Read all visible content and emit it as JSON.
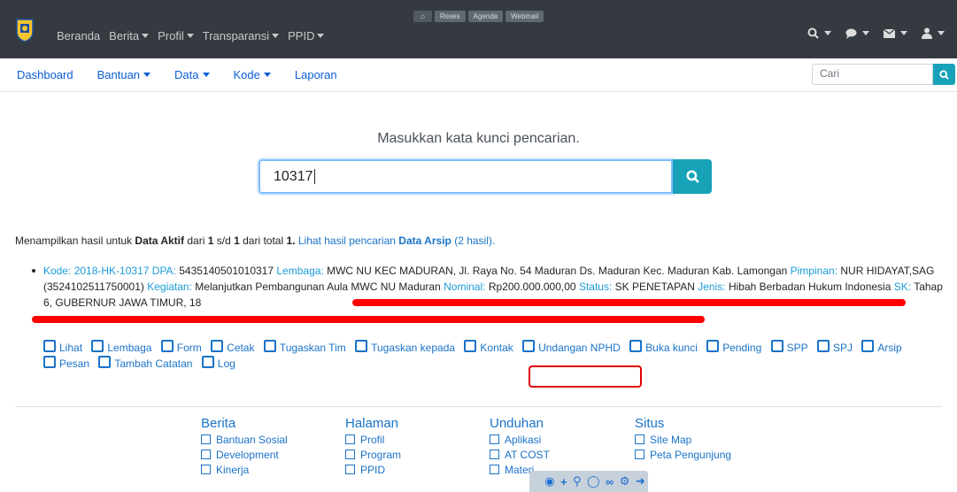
{
  "topbar": {
    "nav": [
      {
        "label": "Beranda",
        "dropdown": false
      },
      {
        "label": "Berita",
        "dropdown": true
      },
      {
        "label": "Profil",
        "dropdown": true
      },
      {
        "label": "Transparansi",
        "dropdown": true
      },
      {
        "label": "PPID",
        "dropdown": true
      }
    ],
    "quicklinks": [
      "Reses",
      "Agenda",
      "Webmail"
    ],
    "icons": [
      "home-icon",
      "search-icon",
      "chat-icon",
      "mail-icon",
      "user-icon"
    ]
  },
  "subnav": {
    "links": [
      {
        "label": "Dashboard"
      },
      {
        "label": "Bantuan"
      },
      {
        "label": "Data"
      },
      {
        "label": "Kode"
      },
      {
        "label": "Laporan"
      }
    ],
    "search_placeholder": "Cari"
  },
  "search": {
    "prompt": "Masukkan kata kunci pencarian.",
    "value": "10317"
  },
  "summary": {
    "prefix": "Menampilkan hasil untuk",
    "dataset": "Data Aktif",
    "dari": "dari",
    "from": "1",
    "sd": "s/d",
    "to": "1",
    "dari_total": "dari total",
    "total": "1.",
    "archive_link_prefix": "Lihat hasil pencarian",
    "archive_link_bold": "Data Arsip",
    "archive_link_count": "(2 hasil)."
  },
  "result": {
    "kode_label": "Kode:",
    "kode": "2018-HK-10317",
    "dpa_label": "DPA:",
    "dpa": "5435140501010317",
    "lembaga_label": "Lembaga:",
    "lembaga": "MWC NU KEC MADURAN, Jl. Raya No. 54 Maduran Ds. Maduran Kec. Maduran Kab. Lamongan",
    "pimpinan_label": "Pimpinan:",
    "pimpinan": "NUR HIDAYAT,SAG (3524102511750001)",
    "kegiatan_label": "Kegiatan:",
    "kegiatan": "Melanjutkan Pembangunan Aula MWC NU Maduran",
    "nominal_label": "Nominal:",
    "nominal": "Rp200.000.000,00",
    "status_label": "Status:",
    "status": "SK PENETAPAN",
    "jenis_label": "Jenis:",
    "jenis": "Hibah Berbadan Hukum Indonesia",
    "sk_label": "SK:",
    "sk": "Tahap 6, GUBERNUR JAWA TIMUR, 18",
    "actions": [
      "Lihat",
      "Lembaga",
      "Form",
      "Cetak",
      "Tugaskan Tim",
      "Tugaskan kepada",
      "Kontak",
      "Undangan NPHD",
      "Buka kunci",
      "Pending",
      "SPP",
      "SPJ",
      "Arsip",
      "Pesan",
      "Tambah Catatan",
      "Log"
    ]
  },
  "footer": {
    "columns": [
      {
        "title": "Berita",
        "items": [
          "Bantuan Sosial",
          "Development",
          "Kinerja"
        ]
      },
      {
        "title": "Halaman",
        "items": [
          "Profil",
          "Program",
          "PPID"
        ]
      },
      {
        "title": "Unduhan",
        "items": [
          "Aplikasi",
          "AT COST",
          "Materi"
        ]
      },
      {
        "title": "Situs",
        "items": [
          "Site Map",
          "Peta Pengunjung"
        ]
      }
    ]
  },
  "colors": {
    "navbar": "#343a40",
    "accent": "#17a2b8",
    "link": "#1a73c8",
    "label": "#1a9bd7",
    "redaction": "#ff0000"
  }
}
